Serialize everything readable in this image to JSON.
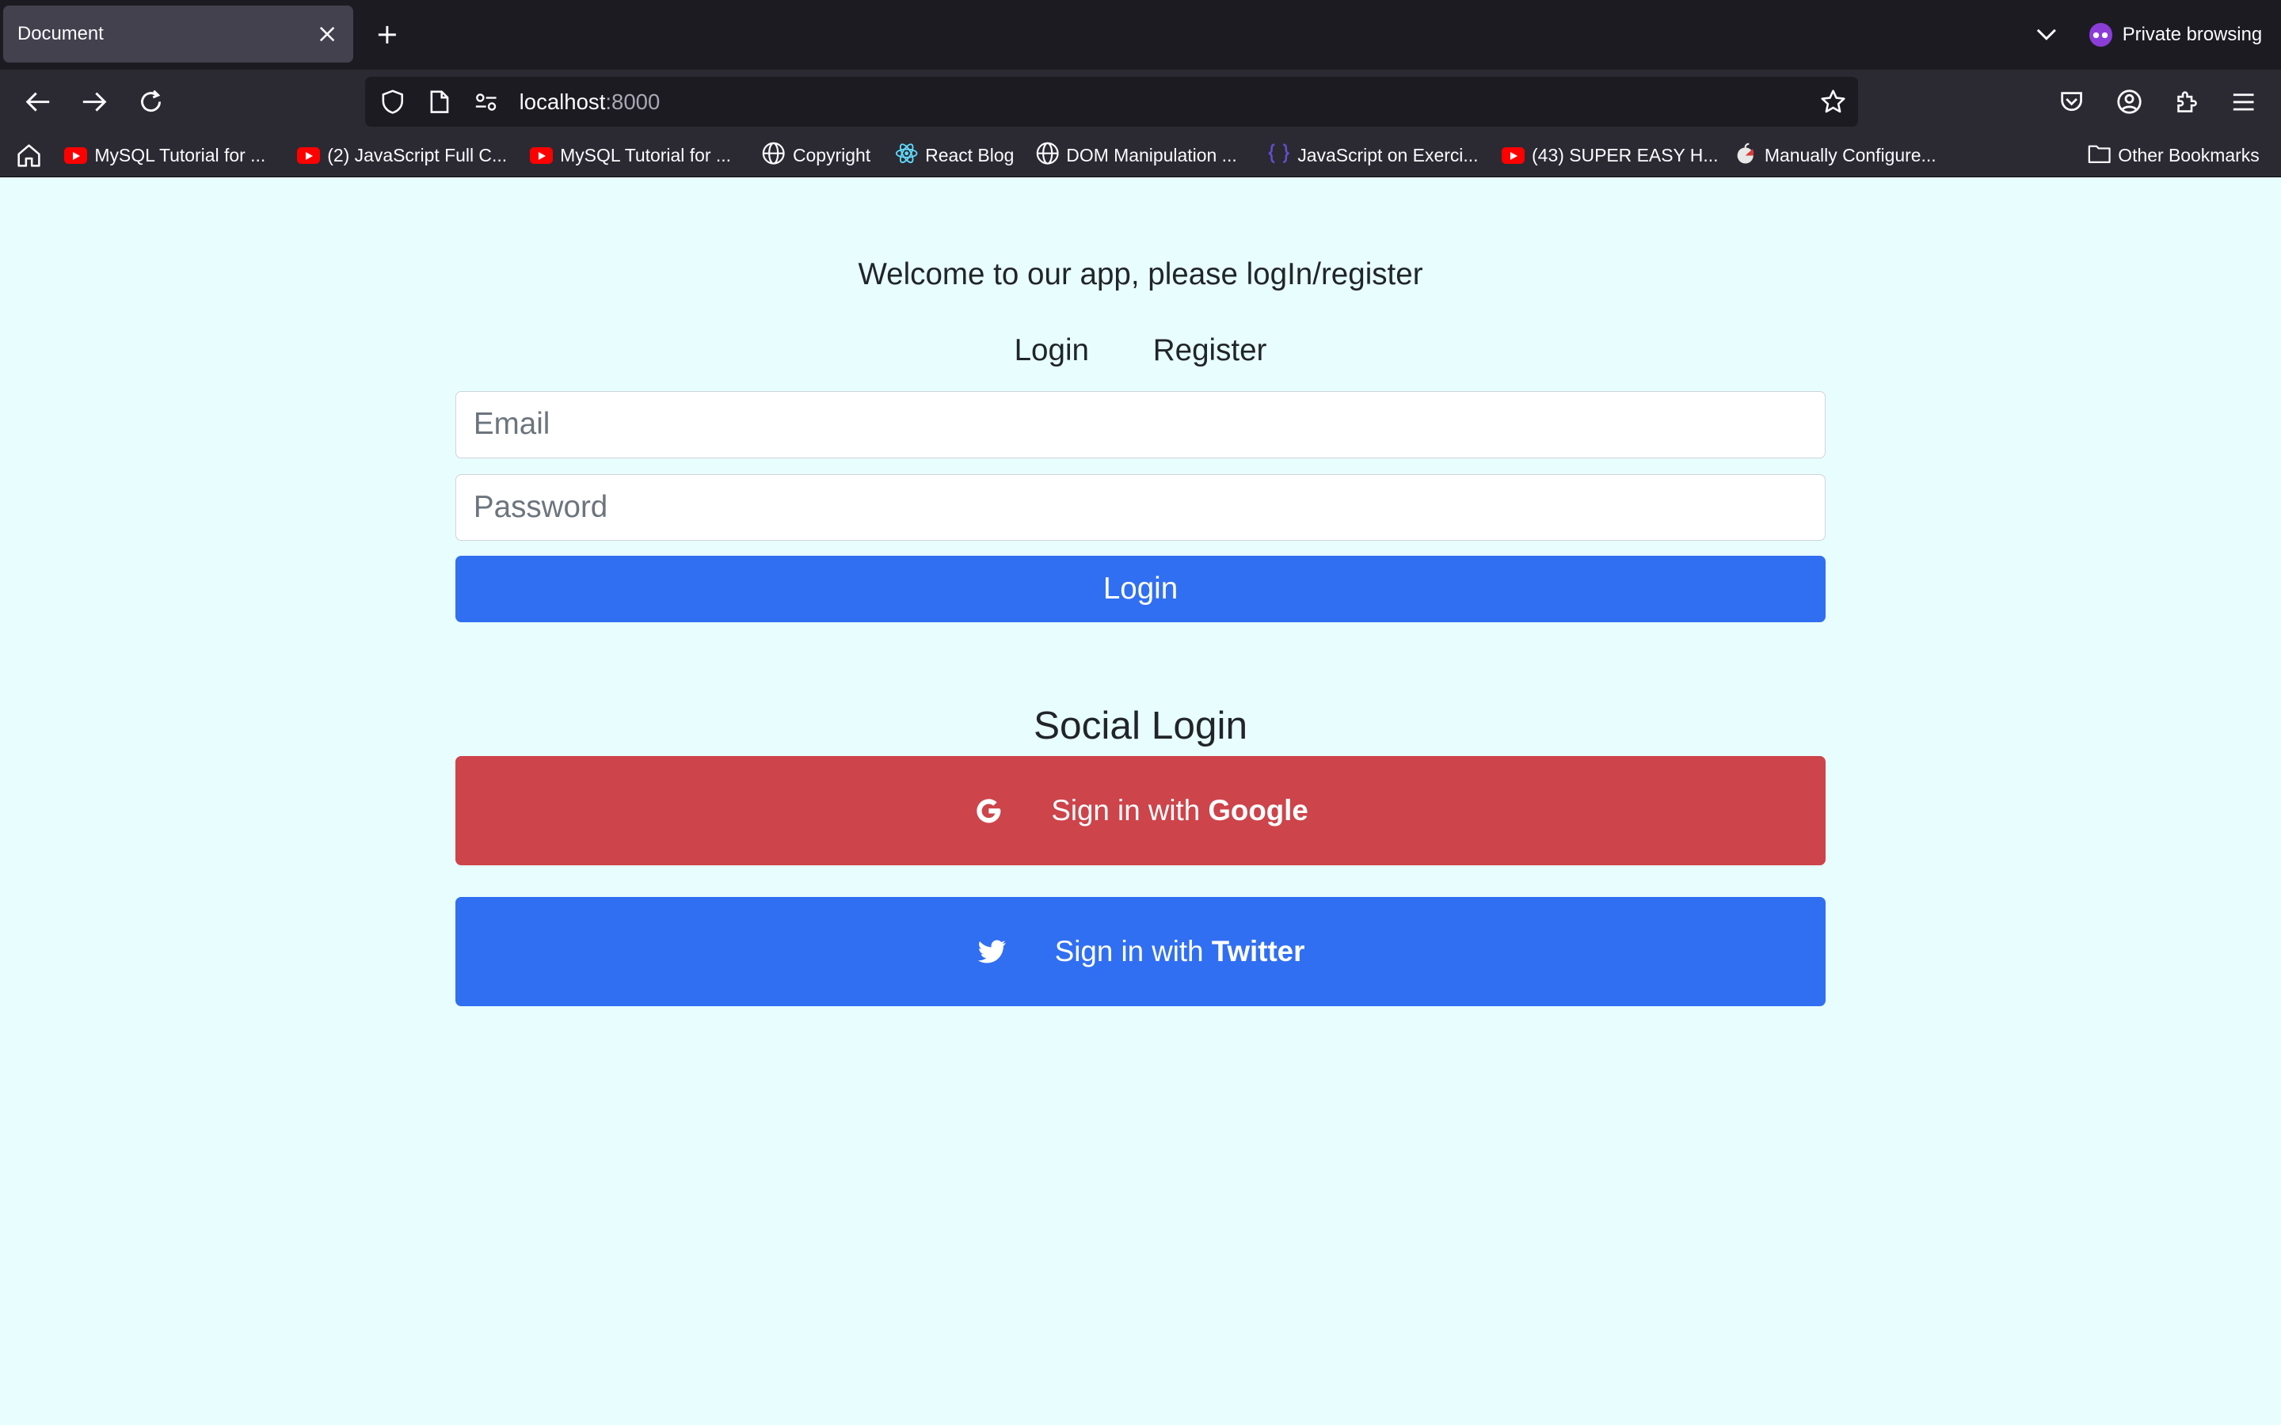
{
  "browser": {
    "tab_title": "Document",
    "private_label": "Private browsing",
    "url_host": "localhost",
    "url_port": ":8000",
    "bookmarks": [
      {
        "label": "MySQL Tutorial for ...",
        "icon": "youtube-icon"
      },
      {
        "label": "(2) JavaScript Full C...",
        "icon": "youtube-icon"
      },
      {
        "label": "MySQL Tutorial for ...",
        "icon": "youtube-icon"
      },
      {
        "label": "Copyright",
        "icon": "globe-icon"
      },
      {
        "label": "React Blog",
        "icon": "react-icon"
      },
      {
        "label": "DOM Manipulation ...",
        "icon": "globe-icon"
      },
      {
        "label": "JavaScript on Exerci...",
        "icon": "exercism-icon"
      },
      {
        "label": "(43) SUPER EASY H...",
        "icon": "youtube-icon"
      },
      {
        "label": "Manually Configure...",
        "icon": "apple-icon"
      }
    ],
    "other_bookmarks": "Other Bookmarks"
  },
  "page": {
    "welcome": "Welcome to our app, please logIn/register",
    "tabs": {
      "login": "Login",
      "register": "Register"
    },
    "email_placeholder": "Email",
    "password_placeholder": "Password",
    "login_button": "Login",
    "social_title": "Social Login",
    "google": {
      "prefix": "Sign in with ",
      "brand": "Google"
    },
    "twitter": {
      "prefix": "Sign in with ",
      "brand": "Twitter"
    }
  },
  "colors": {
    "page_bg": "#e8fefe",
    "primary": "#316ff2",
    "google_red": "#cd444b"
  }
}
